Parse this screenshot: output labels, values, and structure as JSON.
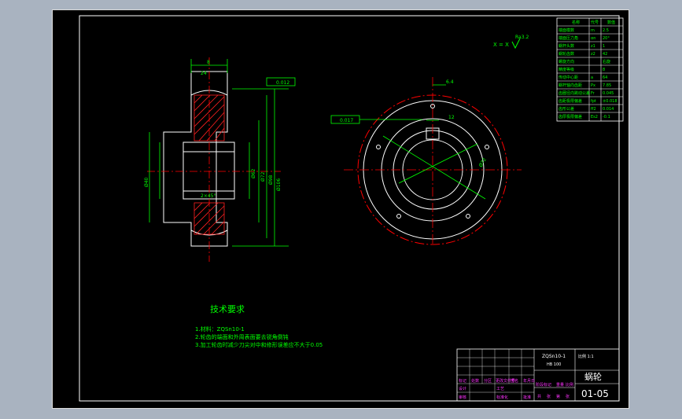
{
  "colors": {
    "background": "#a9b3c0",
    "drawing_area": "#000000",
    "geometry_line": "#ffffff",
    "dimension": "#00ff00",
    "center_line": "#ff0000",
    "title_block_text": "#ff33ff",
    "hatch": "#ff2020"
  },
  "technical_requirements": {
    "heading": "技术要求",
    "items": [
      "1.材料：ZQSn10-1",
      "2.轮齿的端面和外周表面要去锐角倒钝",
      "3.加工轮齿时减少刀尖对中和修形误差应不大于0.05"
    ],
    "tolerance_tail": "±0.05"
  },
  "parameter_table": {
    "header": [
      "名称",
      "代号",
      "数值"
    ],
    "rows": [
      [
        "端面模数",
        "m",
        "2.5"
      ],
      [
        "端面压力角",
        "αn",
        "20°"
      ],
      [
        "蜗杆头数",
        "z1",
        "1"
      ],
      [
        "蜗轮齿数",
        "z2",
        "42"
      ],
      [
        "螺旋方向",
        "",
        "右旋"
      ],
      [
        "精度等级",
        "",
        "8"
      ],
      [
        "传动中心距",
        "a",
        "64"
      ],
      [
        "蜗杆轴向齿距",
        "Px",
        "7.85"
      ],
      [
        "齿圈径向跳动公差",
        "Fr",
        "0.045"
      ],
      [
        "齿距极限偏差",
        "fpt",
        "±0.018"
      ],
      [
        "齿形公差",
        "ff2",
        "0.014"
      ],
      [
        "齿厚极限偏差",
        "Es2",
        "-0.1"
      ]
    ]
  },
  "surface_finish": {
    "label": "X = X",
    "value": "Ra3.2"
  },
  "front_view_dims": [
    "Ø106",
    "Ø98",
    "Ø72",
    "Ø62",
    "Ø40",
    "2×45°",
    "8",
    "24",
    "0.012"
  ],
  "side_view_dims": [
    "0.017",
    "12",
    "Ø72",
    "6.4"
  ],
  "title_block": {
    "material": "ZQSn10-1",
    "hardness": "HB 100",
    "scale": "比例 1:1",
    "part_name": "蜗轮",
    "drawing_no": "01-05",
    "grid_labels": [
      "标记",
      "处数",
      "分区",
      "更改文件号",
      "签名",
      "年月日"
    ],
    "bottom_labels": [
      "设计",
      "审核",
      "工艺",
      "标准化",
      "批准",
      "阶段标记",
      "重量",
      "比例"
    ],
    "sheet_labels": [
      "共",
      "张",
      "第",
      "张"
    ]
  }
}
